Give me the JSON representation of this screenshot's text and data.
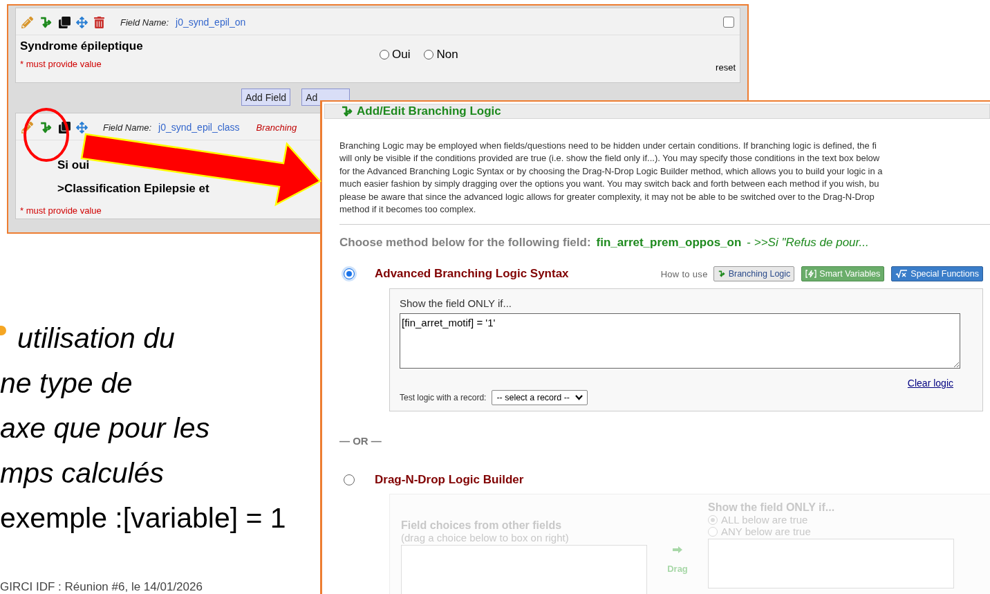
{
  "editor": {
    "fields": [
      {
        "field_name_label": "Field Name:",
        "field_name": "j0_synd_epil_on",
        "checked": false,
        "label_lines": [
          "Syndrome épileptique"
        ],
        "required_note": "* must provide value",
        "options": [
          {
            "label": "Oui",
            "selected": false
          },
          {
            "label": "Non",
            "selected": false
          }
        ],
        "reset": "reset"
      },
      {
        "field_name_label": "Field Name:",
        "field_name": "j0_synd_epil_class",
        "branching_tag": "Branching",
        "label_lines": [
          "Si oui",
          ">Classification Epilepsie et"
        ],
        "required_note": "* must provide value"
      }
    ],
    "buttons": [
      "Add Field",
      "Ad"
    ]
  },
  "dialog": {
    "title": "Add/Edit Branching Logic",
    "description_lines": [
      "Branching Logic may be employed when fields/questions need to be hidden under certain conditions. If branching logic is defined, the fi",
      "will only be visible if the conditions provided are true (i.e. show the field only if...). You may specify those conditions in the text box below",
      "for the Advanced Branching Logic Syntax or by choosing the Drag-N-Drop Logic Builder method, which allows you to build your logic in a",
      "much easier fashion by simply dragging over the options you want. You may switch back and forth between each method if you wish, bu",
      "please be aware that since the advanced logic allows for greater complexity, it may not be able to be switched over to the Drag-N-Drop",
      "method if it becomes too complex."
    ],
    "prompt": {
      "label": "Choose method below for the following field:",
      "field": "fin_arret_prem_oppos_on",
      "description": "- *>>Si \"Refus de pour...*"
    },
    "methods": [
      {
        "kind": "advanced",
        "title": "Advanced Branching Logic Syntax",
        "selected": true,
        "how_to_use": "How to use",
        "help_buttons": [
          {
            "kind": "branching",
            "label": "Branching Logic"
          },
          {
            "kind": "smart",
            "label": "Smart Variables"
          },
          {
            "kind": "functions",
            "label": "Special Functions"
          }
        ],
        "show_label": "Show the field ONLY if...",
        "logic": "[fin_arret_motif] = '1'",
        "clear": "Clear logic",
        "test_label": "Test logic with a record:",
        "record_select": "-- select a record --"
      },
      {
        "kind": "builder",
        "title": "Drag-N-Drop Logic Builder",
        "selected": false,
        "choices_title": "Field choices from other fields",
        "choices_hint": "(drag a choice below to box on right)",
        "show_label": "Show the field ONLY if...",
        "match_options": [
          {
            "label": "ALL below are true",
            "selected": true
          },
          {
            "label": "ANY below are true",
            "selected": false
          }
        ],
        "drag_label": "Drag"
      }
    ],
    "separator": "— OR —"
  },
  "slide": {
    "text_lines": [
      {
        "text": "utilisation du",
        "italic": true
      },
      {
        "text": "ne type de",
        "italic": true
      },
      {
        "text": "axe que pour les",
        "italic": true
      },
      {
        "text": "mps calculés",
        "italic": true
      },
      {
        "text": "exemple :[variable] = 1",
        "italic": false
      }
    ],
    "footer": "GIRCI IDF : Réunion #6, le 14/01/2026"
  }
}
